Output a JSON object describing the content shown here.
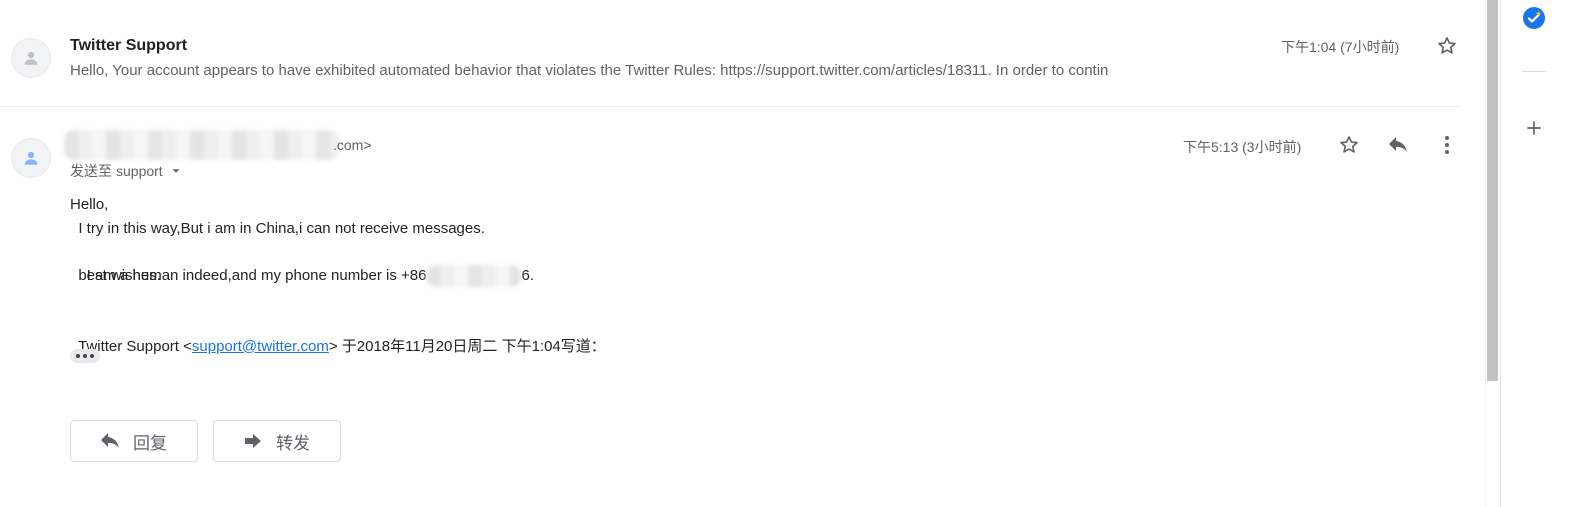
{
  "collapsed_message": {
    "sender": "Twitter Support",
    "snippet": "Hello, Your account appears to have exhibited automated behavior that violates the Twitter Rules: https://support.twitter.com/articles/18311. In order to contin",
    "time": "下午1:04 (7小时前)"
  },
  "expanded_message": {
    "sender_suffix": ".com>",
    "recipient_prefix": "发送至",
    "recipient": "support",
    "time": "下午5:13 (3小时前)",
    "body": {
      "line1": "Hello,",
      "line2": "  I try in this way,But i am in China,i can not receive messages.",
      "line3_prefix": "  I am a human indeed,and my phone number is +86",
      "line3_suffix": "6.",
      "line4": "  best wishes."
    },
    "quote": {
      "prefix": "Twitter Support <",
      "email": "support@twitter.com",
      "suffix": "> 于2018年11月20日周二 下午1:04写道："
    }
  },
  "actions": {
    "reply_label": "回复",
    "forward_label": "转发"
  }
}
